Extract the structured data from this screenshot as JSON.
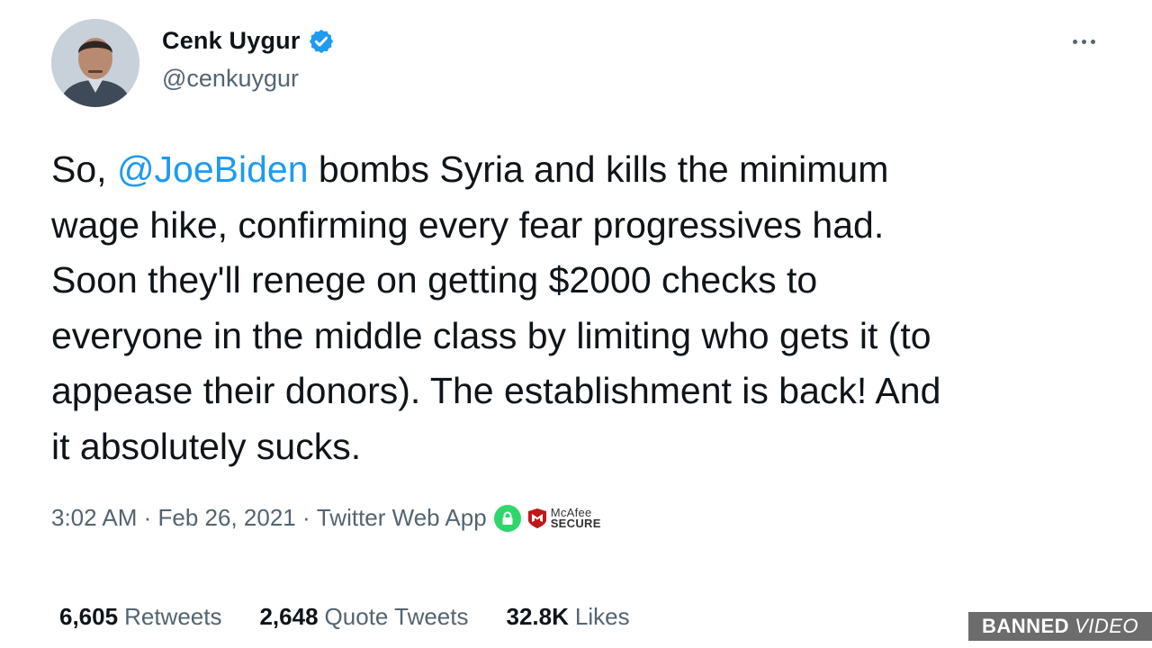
{
  "author": {
    "display_name": "Cenk Uygur",
    "handle": "@cenkuygur",
    "verified_icon": "verified-badge-icon",
    "avatar_icon": "avatar"
  },
  "tweet": {
    "intro": "So, ",
    "mention": "@JoeBiden",
    "body": " bombs Syria and kills the minimum\nwage hike, confirming every fear progressives had.\nSoon they'll renege on getting $2000 checks to\neveryone in the middle class by limiting who gets it (to\nappease their donors). The establishment is back! And\nit absolutely sucks."
  },
  "meta": {
    "time": "3:02 AM",
    "sep1": " · ",
    "date": "Feb 26, 2021",
    "sep2": " · ",
    "source": "Twitter Web App",
    "mcafee_line1": "McAfee",
    "mcafee_line2": "SECURE"
  },
  "stats": {
    "retweets_count": "6,605",
    "retweets_label": "Retweets",
    "quotes_count": "2,648",
    "quotes_label": "Quote Tweets",
    "likes_count": "32.8K",
    "likes_label": "Likes"
  },
  "watermark": {
    "part1": "BANNED",
    "part2": "VIDEO"
  },
  "colors": {
    "accent": "#1d9bf0",
    "secondary_text": "#536471",
    "primary_text": "#0f1419"
  }
}
